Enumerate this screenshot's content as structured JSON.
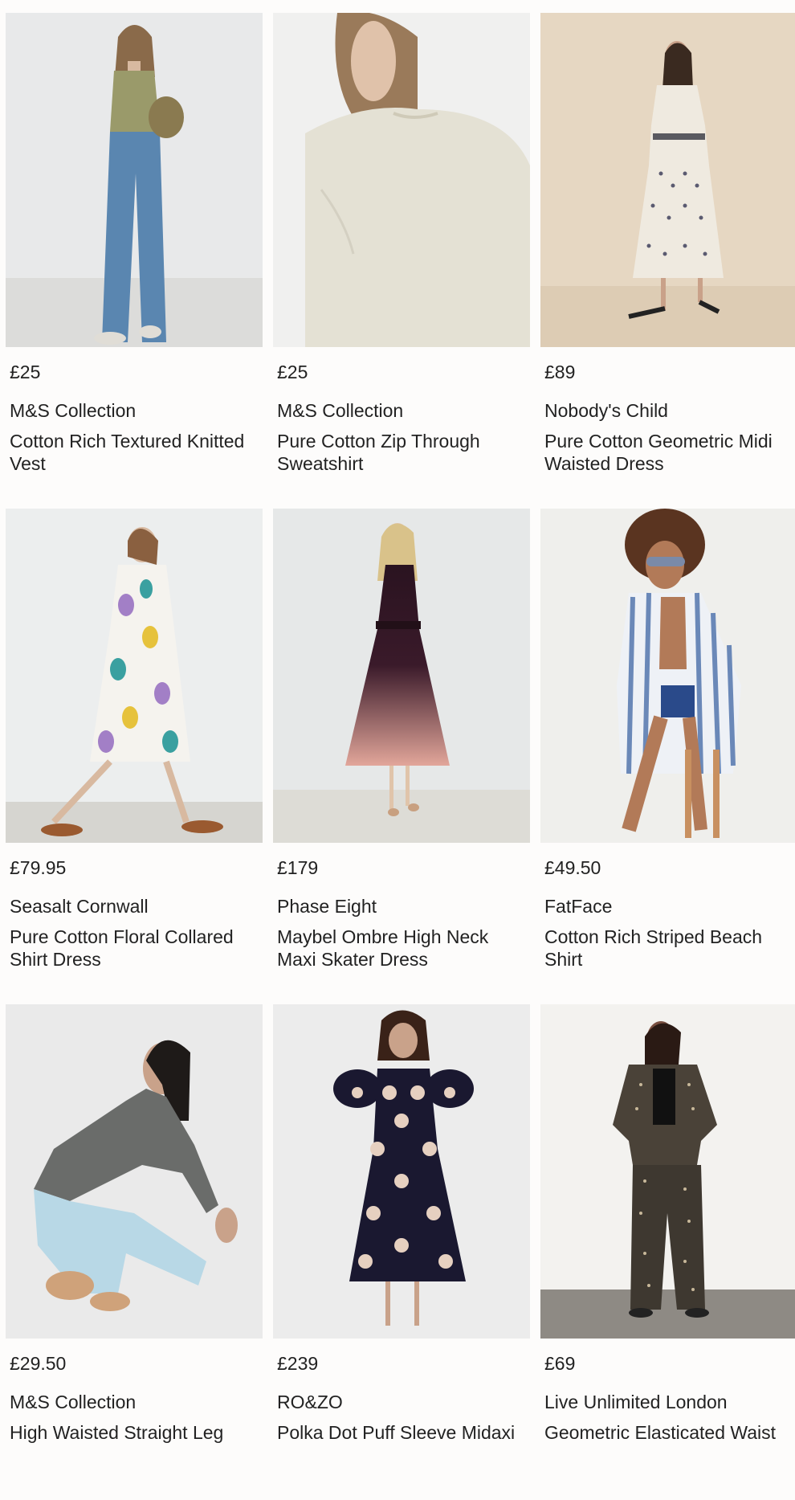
{
  "products": [
    {
      "price": "£25",
      "brand": "M&S Collection",
      "name": "Cotton Rich Textured Knitted Vest",
      "image": "woman-olive-knit-vest-blue-jeans"
    },
    {
      "price": "£25",
      "brand": "M&S Collection",
      "name": "Pure Cotton Zip Through Sweatshirt",
      "image": "woman-back-cream-sweatshirt"
    },
    {
      "price": "£89",
      "brand": "Nobody's Child",
      "name": "Pure Cotton Geometric Midi Waisted Dress",
      "image": "woman-white-geometric-midi-dress"
    },
    {
      "price": "£79.95",
      "brand": "Seasalt Cornwall",
      "name": "Pure Cotton Floral Collared Shirt Dress",
      "image": "woman-floral-shirt-dress"
    },
    {
      "price": "£179",
      "brand": "Phase Eight",
      "name": "Maybel Ombre High Neck Maxi Skater Dress",
      "image": "woman-ombre-maxi-dress"
    },
    {
      "price": "£49.50",
      "brand": "FatFace",
      "name": "Cotton Rich Striped Beach Shirt",
      "image": "woman-striped-beach-shirt"
    },
    {
      "price": "£29.50",
      "brand": "M&S Collection",
      "name": "High Waisted Straight Leg",
      "image": "woman-crouching-light-jeans"
    },
    {
      "price": "£239",
      "brand": "RO&ZO",
      "name": "Polka Dot Puff Sleeve Midaxi",
      "image": "woman-polka-dot-dress"
    },
    {
      "price": "£69",
      "brand": "Live Unlimited London",
      "name": "Geometric Elasticated Waist",
      "image": "woman-geometric-print-coord"
    }
  ],
  "colors": {
    "text": "#222222",
    "background": "#fdfcfb"
  }
}
